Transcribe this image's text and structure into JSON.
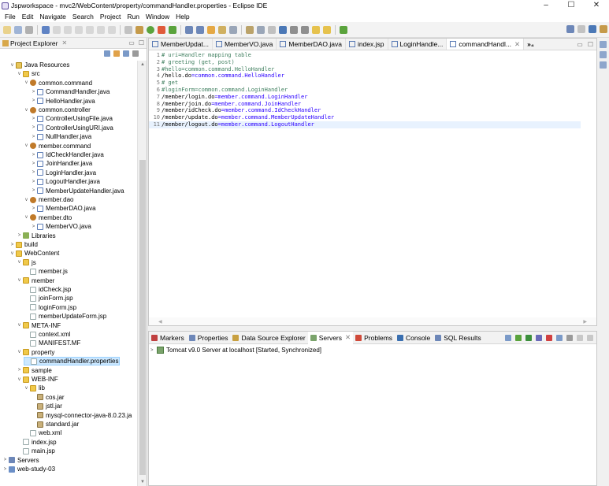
{
  "window": {
    "title": "Jspworkspace - mvc2/WebContent/property/commandHandler.properties - Eclipse IDE",
    "minimize": "–",
    "maximize": "☐",
    "close": "✕"
  },
  "menu": [
    "File",
    "Edit",
    "Navigate",
    "Search",
    "Project",
    "Run",
    "Window",
    "Help"
  ],
  "project_explorer": {
    "tab_label": "Project Explorer",
    "close": "✕",
    "minimize": "▭",
    "maximize": "☐",
    "tree": [
      {
        "depth": 1,
        "twisty": "v",
        "icon": "res",
        "label": "Java Resources"
      },
      {
        "depth": 2,
        "twisty": "v",
        "icon": "folder",
        "label": "src"
      },
      {
        "depth": 3,
        "twisty": "v",
        "icon": "pkg",
        "label": "common.command"
      },
      {
        "depth": 4,
        "twisty": ">",
        "icon": "java",
        "label": "CommandHandler.java"
      },
      {
        "depth": 4,
        "twisty": ">",
        "icon": "java",
        "label": "HelloHandler.java"
      },
      {
        "depth": 3,
        "twisty": "v",
        "icon": "pkg",
        "label": "common.controller"
      },
      {
        "depth": 4,
        "twisty": ">",
        "icon": "java",
        "label": "ControllerUsingFile.java"
      },
      {
        "depth": 4,
        "twisty": ">",
        "icon": "java",
        "label": "ControllerUsingURI.java"
      },
      {
        "depth": 4,
        "twisty": ">",
        "icon": "java",
        "label": "NullHandler.java"
      },
      {
        "depth": 3,
        "twisty": "v",
        "icon": "pkg",
        "label": "member.command"
      },
      {
        "depth": 4,
        "twisty": ">",
        "icon": "java",
        "label": "IdCheckHandler.java"
      },
      {
        "depth": 4,
        "twisty": ">",
        "icon": "java",
        "label": "JoinHandler.java"
      },
      {
        "depth": 4,
        "twisty": ">",
        "icon": "java",
        "label": "LoginHandler.java"
      },
      {
        "depth": 4,
        "twisty": ">",
        "icon": "java",
        "label": "LogoutHandler.java"
      },
      {
        "depth": 4,
        "twisty": ">",
        "icon": "java",
        "label": "MemberUpdateHandler.java"
      },
      {
        "depth": 3,
        "twisty": "v",
        "icon": "pkg",
        "label": "member.dao"
      },
      {
        "depth": 4,
        "twisty": ">",
        "icon": "java",
        "label": "MemberDAO.java"
      },
      {
        "depth": 3,
        "twisty": "v",
        "icon": "pkg",
        "label": "member.dto"
      },
      {
        "depth": 4,
        "twisty": ">",
        "icon": "java",
        "label": "MemberVO.java"
      },
      {
        "depth": 2,
        "twisty": ">",
        "icon": "lib",
        "label": "Libraries"
      },
      {
        "depth": 1,
        "twisty": ">",
        "icon": "folder",
        "label": "build"
      },
      {
        "depth": 1,
        "twisty": "v",
        "icon": "folder",
        "label": "WebContent"
      },
      {
        "depth": 2,
        "twisty": "v",
        "icon": "folder",
        "label": "js"
      },
      {
        "depth": 3,
        "twisty": "",
        "icon": "file",
        "label": "member.js"
      },
      {
        "depth": 2,
        "twisty": "v",
        "icon": "folder",
        "label": "member"
      },
      {
        "depth": 3,
        "twisty": "",
        "icon": "file",
        "label": "idCheck.jsp"
      },
      {
        "depth": 3,
        "twisty": "",
        "icon": "file",
        "label": "joinForm.jsp"
      },
      {
        "depth": 3,
        "twisty": "",
        "icon": "file",
        "label": "loginForm.jsp"
      },
      {
        "depth": 3,
        "twisty": "",
        "icon": "file",
        "label": "memberUpdateForm.jsp"
      },
      {
        "depth": 2,
        "twisty": "v",
        "icon": "folder",
        "label": "META-INF"
      },
      {
        "depth": 3,
        "twisty": "",
        "icon": "file",
        "label": "context.xml"
      },
      {
        "depth": 3,
        "twisty": "",
        "icon": "file",
        "label": "MANIFEST.MF"
      },
      {
        "depth": 2,
        "twisty": "v",
        "icon": "folder",
        "label": "property"
      },
      {
        "depth": 3,
        "twisty": "",
        "icon": "file",
        "label": "commandHandler.properties",
        "selected": true
      },
      {
        "depth": 2,
        "twisty": ">",
        "icon": "folder",
        "label": "sample"
      },
      {
        "depth": 2,
        "twisty": "v",
        "icon": "folder",
        "label": "WEB-INF"
      },
      {
        "depth": 3,
        "twisty": "v",
        "icon": "folder",
        "label": "lib"
      },
      {
        "depth": 4,
        "twisty": "",
        "icon": "jar",
        "label": "cos.jar"
      },
      {
        "depth": 4,
        "twisty": "",
        "icon": "jar",
        "label": "jstl.jar"
      },
      {
        "depth": 4,
        "twisty": "",
        "icon": "jar",
        "label": "mysql-connector-java-8.0.23.ja"
      },
      {
        "depth": 4,
        "twisty": "",
        "icon": "jar",
        "label": "standard.jar"
      },
      {
        "depth": 3,
        "twisty": "",
        "icon": "file",
        "label": "web.xml"
      },
      {
        "depth": 2,
        "twisty": "",
        "icon": "file",
        "label": "index.jsp"
      },
      {
        "depth": 2,
        "twisty": "",
        "icon": "file",
        "label": "main.jsp"
      },
      {
        "depth": 0,
        "twisty": ">",
        "icon": "srv",
        "label": "Servers"
      },
      {
        "depth": 0,
        "twisty": ">",
        "icon": "proj",
        "label": "web-study-03"
      }
    ]
  },
  "editor": {
    "tabs": [
      {
        "label": "MemberUpdat...",
        "active": false
      },
      {
        "label": "MemberVO.java",
        "active": false
      },
      {
        "label": "MemberDAO.java",
        "active": false
      },
      {
        "label": "index.jsp",
        "active": false
      },
      {
        "label": "LoginHandle...",
        "active": false
      },
      {
        "label": "commandHandl...",
        "active": true
      }
    ],
    "overflow_label": "»₄",
    "active_close": "✕",
    "minimize": "▭",
    "maximize": "☐",
    "lines": [
      {
        "n": "1",
        "kind": "comment",
        "text": "# uri=Handler mapping table"
      },
      {
        "n": "2",
        "kind": "comment",
        "text": "# greeting (get, post)"
      },
      {
        "n": "3",
        "kind": "comment",
        "text": "#hello=common.command.HelloHandler"
      },
      {
        "n": "4",
        "kind": "pair",
        "key": "/hello.do",
        "value": "=common.command.HelloHandler"
      },
      {
        "n": "5",
        "kind": "comment",
        "text": "# get"
      },
      {
        "n": "6",
        "kind": "comment",
        "text": "#loginForm=common.command.LoginHandler"
      },
      {
        "n": "7",
        "kind": "pair",
        "key": "/member/login.do",
        "value": "=member.command.LoginHandler"
      },
      {
        "n": "8",
        "kind": "pair",
        "key": "/member/join.do",
        "value": "=member.command.JoinHandler"
      },
      {
        "n": "9",
        "kind": "pair",
        "key": "/member/idCheck.do",
        "value": "=member.command.IdCheckHandler"
      },
      {
        "n": "10",
        "kind": "pair",
        "key": "/member/update.do",
        "value": "=member.command.MemberUpdateHandler"
      },
      {
        "n": "11",
        "kind": "pair",
        "key": "/member/logout.do",
        "value": "=member.command.LogoutHandler",
        "current": true
      }
    ]
  },
  "bottom_panel": {
    "tabs": [
      {
        "label": "Markers",
        "icon": "#c04040"
      },
      {
        "label": "Properties",
        "icon": "#6d87b8"
      },
      {
        "label": "Data Source Explorer",
        "icon": "#c8a040"
      },
      {
        "label": "Servers",
        "icon": "#7aa36b",
        "active": true
      },
      {
        "label": "Problems",
        "icon": "#d04a3a"
      },
      {
        "label": "Console",
        "icon": "#3a6fb0"
      },
      {
        "label": "SQL Results",
        "icon": "#6d87b8"
      }
    ],
    "servers_close": "✕",
    "server_row": "Tomcat v9.0 Server at localhost  [Started, Synchronized]"
  },
  "colors": {
    "comment": "#3f7f5f",
    "value": "#2a00ff",
    "selection": "#cce8ff",
    "current_line": "#e8f2fe"
  }
}
